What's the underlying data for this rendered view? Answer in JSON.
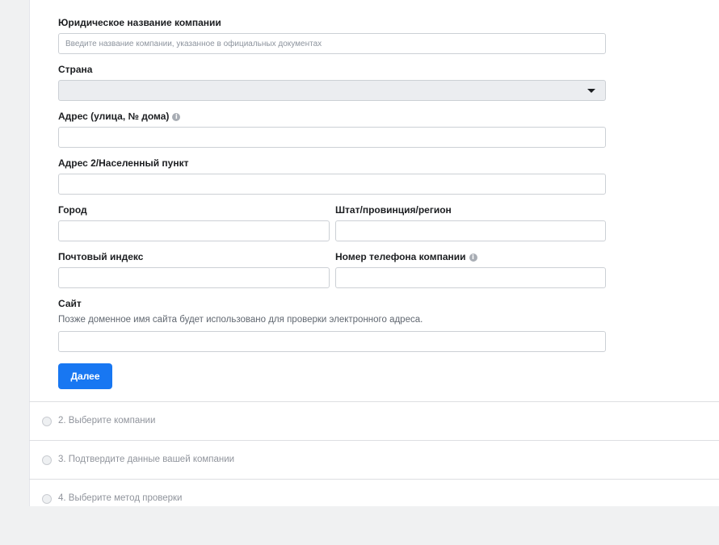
{
  "form": {
    "legal_name": {
      "label": "Юридическое название компании",
      "placeholder": "Введите название компании, указанное в официальных документах",
      "value": ""
    },
    "country": {
      "label": "Страна",
      "value": ""
    },
    "address": {
      "label": "Адрес (улица, № дома)",
      "info_icon": "info-icon",
      "value": ""
    },
    "address2": {
      "label": "Адрес 2/Населенный пункт",
      "value": ""
    },
    "city": {
      "label": "Город",
      "value": ""
    },
    "state": {
      "label": "Штат/провинция/регион",
      "value": ""
    },
    "zip": {
      "label": "Почтовый индекс",
      "value": ""
    },
    "phone": {
      "label": "Номер телефона компании",
      "info_icon": "info-icon",
      "value": ""
    },
    "website": {
      "label": "Сайт",
      "help": "Позже доменное имя сайта будет использовано для проверки электронного адреса.",
      "value": ""
    },
    "next_label": "Далее"
  },
  "steps": [
    {
      "label": "2. Выберите компании"
    },
    {
      "label": "3. Подтвердите данные вашей компании"
    },
    {
      "label": "4. Выберите метод проверки"
    }
  ],
  "colors": {
    "primary": "#1877f2",
    "background": "#f0f1f2",
    "muted_text": "#90949c"
  }
}
